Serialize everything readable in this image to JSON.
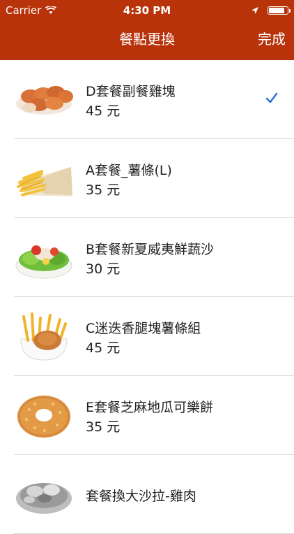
{
  "status": {
    "carrier": "Carrier",
    "time": "4:30 PM"
  },
  "nav": {
    "title": "餐點更換",
    "done": "完成"
  },
  "colors": {
    "header": "#b8320a",
    "check": "#2a6fd6"
  },
  "items": [
    {
      "name": "D套餐副餐雞塊",
      "price": "45 元",
      "selected": true,
      "icon": "chicken-nuggets-icon"
    },
    {
      "name": "A套餐_薯條(L)",
      "price": "35 元",
      "selected": false,
      "icon": "french-fries-icon"
    },
    {
      "name": "B套餐新夏威夷鮮蔬沙",
      "price": "30 元",
      "selected": false,
      "icon": "salad-icon"
    },
    {
      "name": "C迷迭香腿塊薯條組",
      "price": "45 元",
      "selected": false,
      "icon": "fries-chicken-combo-icon"
    },
    {
      "name": "E套餐芝麻地瓜可樂餅",
      "price": "35 元",
      "selected": false,
      "icon": "sweet-potato-donut-icon"
    },
    {
      "name": "套餐換大沙拉-雞肉",
      "price": "",
      "selected": false,
      "icon": "chicken-salad-icon"
    }
  ]
}
